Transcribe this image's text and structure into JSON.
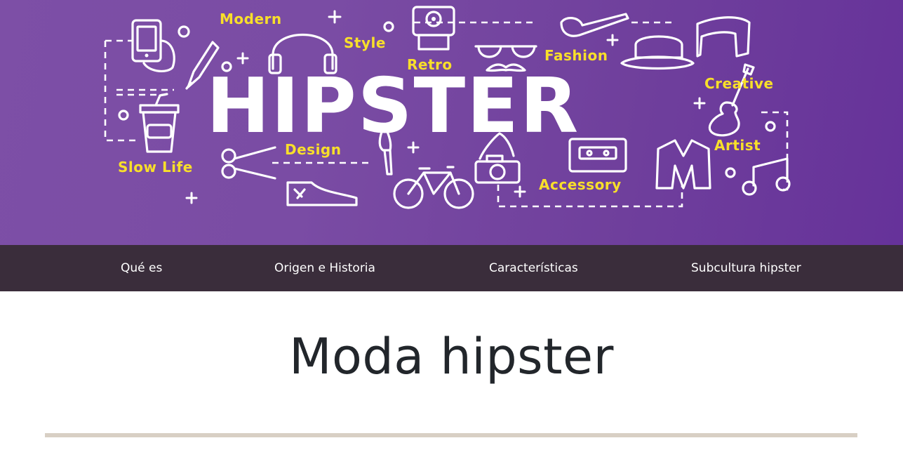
{
  "banner": {
    "alt": "Hipster word cloud illustration",
    "main_word": "HIPSTER",
    "words": {
      "modern": "Modern",
      "style": "Style",
      "retro": "Retro",
      "fashion": "Fashion",
      "creative": "Creative",
      "design": "Design",
      "slow_life": "Slow Life",
      "artist": "Artist",
      "accessory": "Accessory"
    },
    "colors": {
      "background": "#7a4ca4",
      "words": "#f8df2a",
      "lines": "#ffffff"
    },
    "icons": [
      "smartphone-icon",
      "headphones-icon",
      "pen-nib-icon",
      "instant-camera-icon",
      "glasses-mustache-icon",
      "pipe-icon",
      "hat-icon",
      "scarf-icon",
      "coffee-cup-icon",
      "scissors-icon",
      "brush-icon",
      "bicycle-icon",
      "sneaker-icon",
      "camera-icon",
      "cassette-icon",
      "jacket-icon",
      "guitar-icon",
      "music-note-icon"
    ]
  },
  "nav": {
    "items": [
      {
        "label": "Qué es"
      },
      {
        "label": "Origen e Historia"
      },
      {
        "label": "Características"
      },
      {
        "label": "Subcultura hipster"
      }
    ],
    "background": "#3a2d3b"
  },
  "main": {
    "title": "Moda hipster",
    "divider_color": "#d8cfc4"
  }
}
